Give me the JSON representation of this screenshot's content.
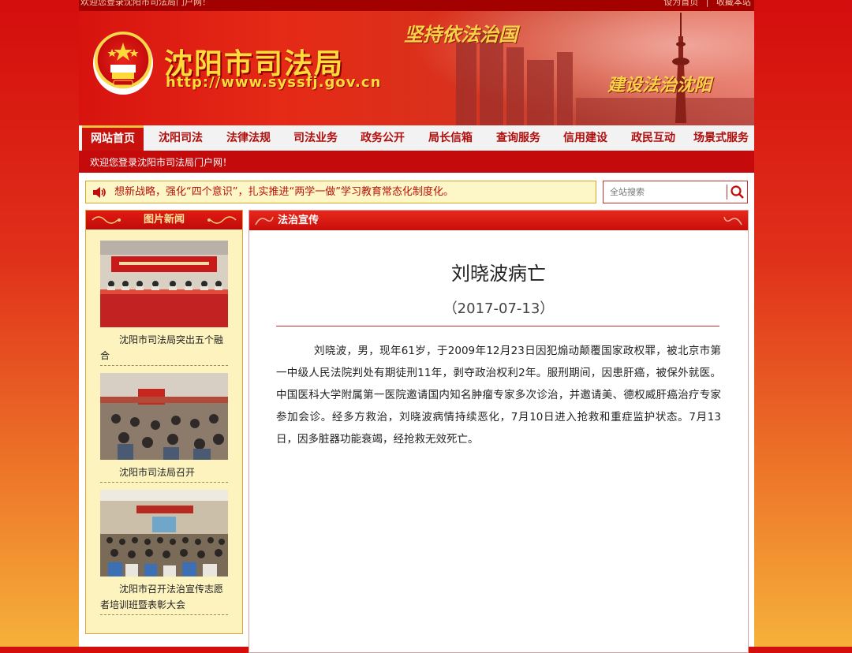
{
  "topbar": {
    "welcome": "欢迎您登录沈阳市司法局门户网！",
    "set_home": "设为首页",
    "separator": "|",
    "bookmark": "收藏本站"
  },
  "banner": {
    "title": "沈阳市司法局",
    "url": "http://www.syssfj.gov.cn",
    "slogan_top": "坚持依法治国",
    "slogan_bottom": "建设法治沈阳",
    "emblem_icon": "court-emblem-icon"
  },
  "nav": {
    "items": [
      {
        "label": "网站首页",
        "active": true
      },
      {
        "label": "沈阳司法"
      },
      {
        "label": "法律法规"
      },
      {
        "label": "司法业务"
      },
      {
        "label": "政务公开"
      },
      {
        "label": "局长信箱"
      },
      {
        "label": "查询服务"
      },
      {
        "label": "信用建设"
      },
      {
        "label": "政民互动"
      },
      {
        "label": "场景式服务"
      }
    ]
  },
  "subbar": {
    "welcome": "欢迎您登录沈阳市司法局门户网！"
  },
  "notice": {
    "icon": "speaker-icon",
    "text": "想新战略，强化“四个意识”，扎实推进“两学一做”学习教育常态化制度化。"
  },
  "search": {
    "placeholder": "全站搜索",
    "icon": "search-icon"
  },
  "picture_news": {
    "title": "图片新闻",
    "items": [
      {
        "caption": "沈阳市司法局突出五个融合"
      },
      {
        "caption": "沈阳市司法局召开"
      },
      {
        "caption": "沈阳市召开法治宣传志愿者培训班暨表彰大会"
      }
    ]
  },
  "article_panel": {
    "section_title": "法治宣传",
    "title": "刘晓波病亡",
    "date": "（2017-07-13）",
    "body": "刘晓波，男，现年61岁，于2009年12月23日因犯煽动颠覆国家政权罪，被北京市第一中级人民法院判处有期徒刑11年，剥夺政治权利2年。服刑期间，因患肝癌，被保外就医。中国医科大学附属第一医院邀请国内知名肿瘤专家多次诊治，并邀请美、德权威肝癌治疗专家参加会诊。经多方救治，刘晓波病情持续恶化，7月10日进入抢救和重症监护状态。7月13日，因多脏器功能衰竭，经抢救无效死亡。"
  },
  "colors": {
    "brand_red": "#c40a0a",
    "gold": "#ffdc3b",
    "notice_bg": "#fdf6c6",
    "sidebar_bg": "#fdf3bf"
  }
}
